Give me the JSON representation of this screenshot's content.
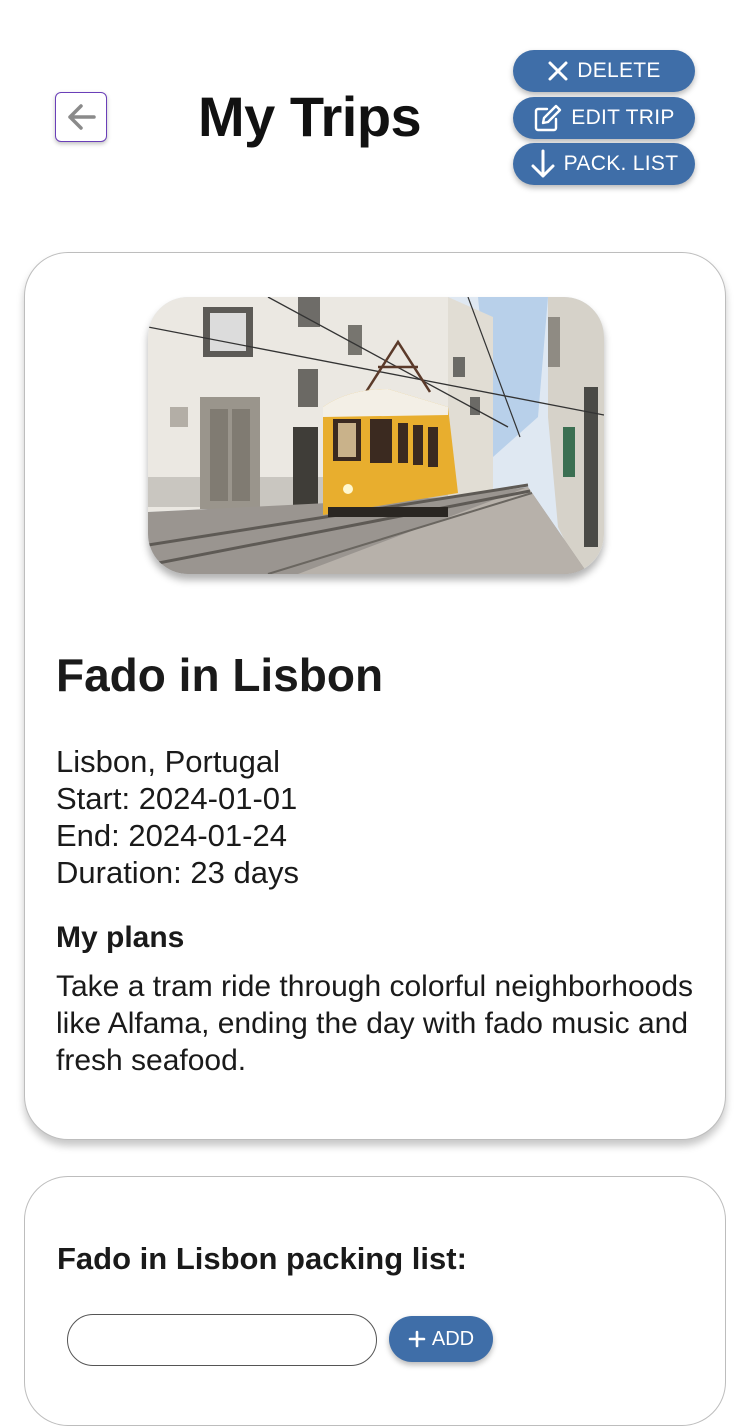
{
  "header": {
    "title": "My Trips",
    "back_icon": "arrow-left-icon"
  },
  "actions": {
    "delete_label": "DELETE",
    "edit_label": "EDIT TRIP",
    "pack_label": "PACK. LIST",
    "delete_icon": "close-icon",
    "edit_icon": "edit-icon",
    "pack_icon": "arrow-down-icon"
  },
  "trip": {
    "name": "Fado in Lisbon",
    "location": "Lisbon, Portugal",
    "start": "Start: 2024-01-01",
    "end": "End: 2024-01-24",
    "duration": "Duration: 23 days",
    "plans_heading": "My plans",
    "plans_text": "Take a tram ride through colorful neighborhoods like Alfama, ending the day with fado music and fresh seafood."
  },
  "packing": {
    "title": "Fado in Lisbon packing list:",
    "input_value": "",
    "add_label": "ADD",
    "add_icon": "plus-icon"
  },
  "colors": {
    "accent": "#3f6ea8",
    "back_border": "#6a3fb8",
    "tram_yellow": "#e8ae2e"
  }
}
